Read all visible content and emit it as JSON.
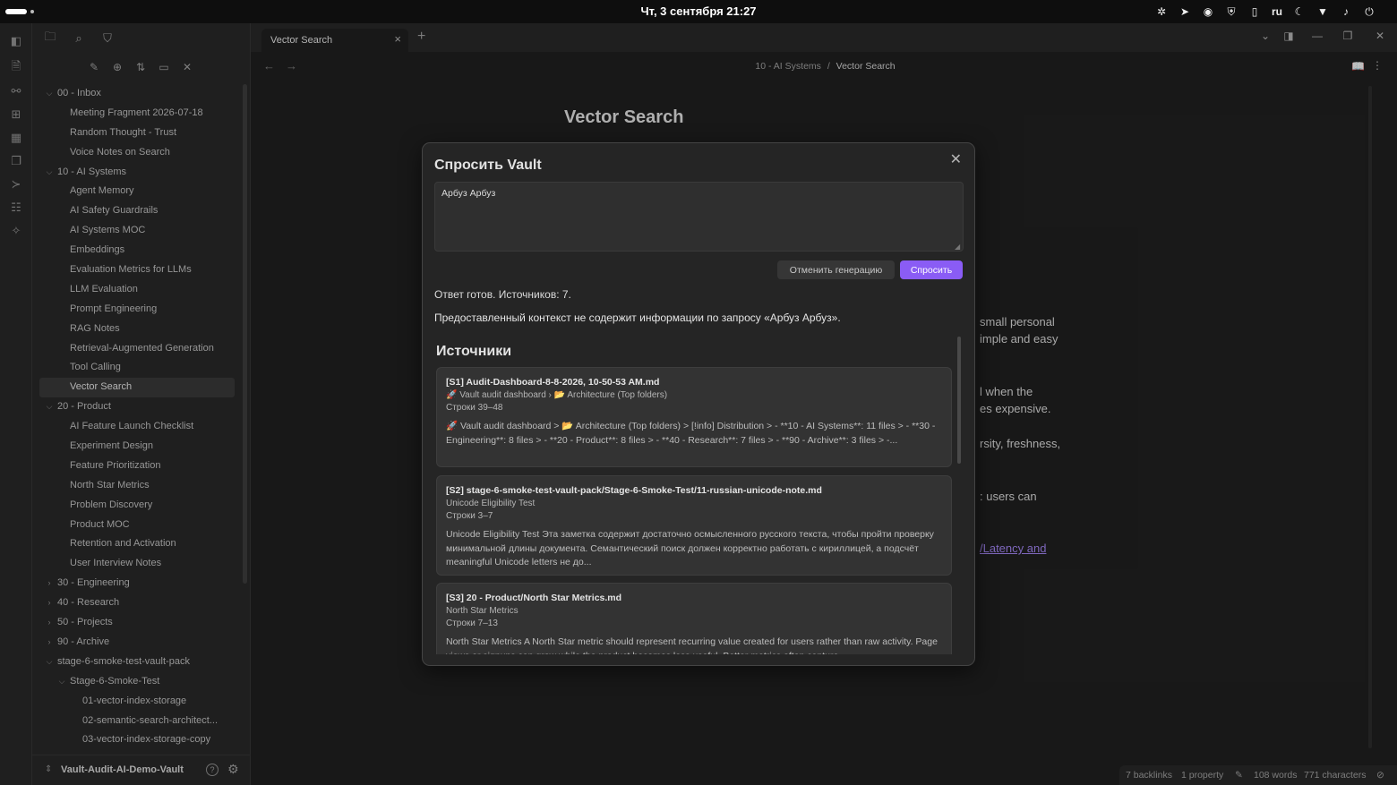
{
  "system": {
    "clock": "Чт, 3 сентября  21:27",
    "lang": "ru",
    "tray_icons": [
      "extensions-icon",
      "telegram-icon",
      "steam-icon",
      "shield-icon",
      "clipboard-icon",
      "language-indicator",
      "night-light-icon",
      "wifi-icon",
      "volume-icon",
      "power-icon"
    ]
  },
  "tabs": {
    "active": "Vector Search"
  },
  "breadcrumb": {
    "folder": "10 - AI Systems",
    "sep": "/",
    "file": "Vector Search"
  },
  "note": {
    "title": "Vector Search",
    "fragments": [
      " small personal",
      "imple and easy",
      "l when the",
      "es expensive.",
      "rsity, freshness,",
      ": users can",
      "/Latency and "
    ]
  },
  "tree": [
    {
      "label": "00 - Inbox",
      "depth": 0,
      "chev": "down"
    },
    {
      "label": "Meeting Fragment 2026-07-18",
      "depth": 1
    },
    {
      "label": "Random Thought - Trust",
      "depth": 1
    },
    {
      "label": "Voice Notes on Search",
      "depth": 1
    },
    {
      "label": "10 - AI Systems",
      "depth": 0,
      "chev": "down"
    },
    {
      "label": "Agent Memory",
      "depth": 1
    },
    {
      "label": "AI Safety Guardrails",
      "depth": 1
    },
    {
      "label": "AI Systems MOC",
      "depth": 1
    },
    {
      "label": "Embeddings",
      "depth": 1
    },
    {
      "label": "Evaluation Metrics for LLMs",
      "depth": 1
    },
    {
      "label": "LLM Evaluation",
      "depth": 1
    },
    {
      "label": "Prompt Engineering",
      "depth": 1
    },
    {
      "label": "RAG Notes",
      "depth": 1
    },
    {
      "label": "Retrieval-Augmented Generation",
      "depth": 1
    },
    {
      "label": "Tool Calling",
      "depth": 1
    },
    {
      "label": "Vector Search",
      "depth": 1,
      "active": true
    },
    {
      "label": "20 - Product",
      "depth": 0,
      "chev": "down"
    },
    {
      "label": "AI Feature Launch Checklist",
      "depth": 1
    },
    {
      "label": "Experiment Design",
      "depth": 1
    },
    {
      "label": "Feature Prioritization",
      "depth": 1
    },
    {
      "label": "North Star Metrics",
      "depth": 1
    },
    {
      "label": "Problem Discovery",
      "depth": 1
    },
    {
      "label": "Product MOC",
      "depth": 1
    },
    {
      "label": "Retention and Activation",
      "depth": 1
    },
    {
      "label": "User Interview Notes",
      "depth": 1
    },
    {
      "label": "30 - Engineering",
      "depth": 0,
      "chev": "right"
    },
    {
      "label": "40 - Research",
      "depth": 0,
      "chev": "right"
    },
    {
      "label": "50 - Projects",
      "depth": 0,
      "chev": "right"
    },
    {
      "label": "90 - Archive",
      "depth": 0,
      "chev": "right"
    },
    {
      "label": "stage-6-smoke-test-vault-pack",
      "depth": 0,
      "chev": "down"
    },
    {
      "label": "Stage-6-Smoke-Test",
      "depth": 1,
      "chev": "down"
    },
    {
      "label": "01-vector-index-storage",
      "depth": 2
    },
    {
      "label": "02-semantic-search-architect...",
      "depth": 2
    },
    {
      "label": "03-vector-index-storage-copy",
      "depth": 2
    }
  ],
  "vault": {
    "name": "Vault-Audit-AI-Demo-Vault",
    "help": "?"
  },
  "status": {
    "backlinks": "7 backlinks",
    "props": "1 property",
    "words": "108 words",
    "chars": "771 characters"
  },
  "modal": {
    "title": "Спросить Vault",
    "query": "Арбуз Арбуз",
    "cancel_label": "Отменить генерацию",
    "ask_label": "Спросить",
    "status": "Ответ готов. Источников: 7.",
    "answer": "Предоставленный контекст не содержит информации по запросу «Арбуз Арбуз».",
    "sources_heading": "Источники",
    "sources": [
      {
        "title": "[S1] Audit-Dashboard-8-8-2026, 10-50-53 AM.md",
        "path": "🚀 Vault audit dashboard › 📂 Architecture (Top folders)",
        "lines": "Строки 39–48",
        "snippet": "🚀 Vault audit dashboard > 📂 Architecture (Top folders) > [!info] Distribution > - **10 - AI Systems**: 11 files > - **30 - Engineering**: 8 files > - **20 - Product**: 8 files > - **40 - Research**: 7 files > - **90 - Archive**: 3 files > -..."
      },
      {
        "title": "[S2] stage-6-smoke-test-vault-pack/Stage-6-Smoke-Test/11-russian-unicode-note.md",
        "path": "Unicode Eligibility Test",
        "lines": "Строки 3–7",
        "snippet": "Unicode Eligibility Test Эта заметка содержит достаточно осмысленного русского текста, чтобы пройти проверку минимальной длины документа. Семантический поиск должен корректно работать с кириллицей, а подсчёт meaningful Unicode letters не до..."
      },
      {
        "title": "[S3] 20 - Product/North Star Metrics.md",
        "path": "North Star Metrics",
        "lines": "Строки 7–13",
        "snippet": "North Star Metrics A North Star metric should represent recurring value created for users rather than raw activity. Page views or signups can grow while the product becomes less useful. Better metrics often capture"
      }
    ]
  }
}
